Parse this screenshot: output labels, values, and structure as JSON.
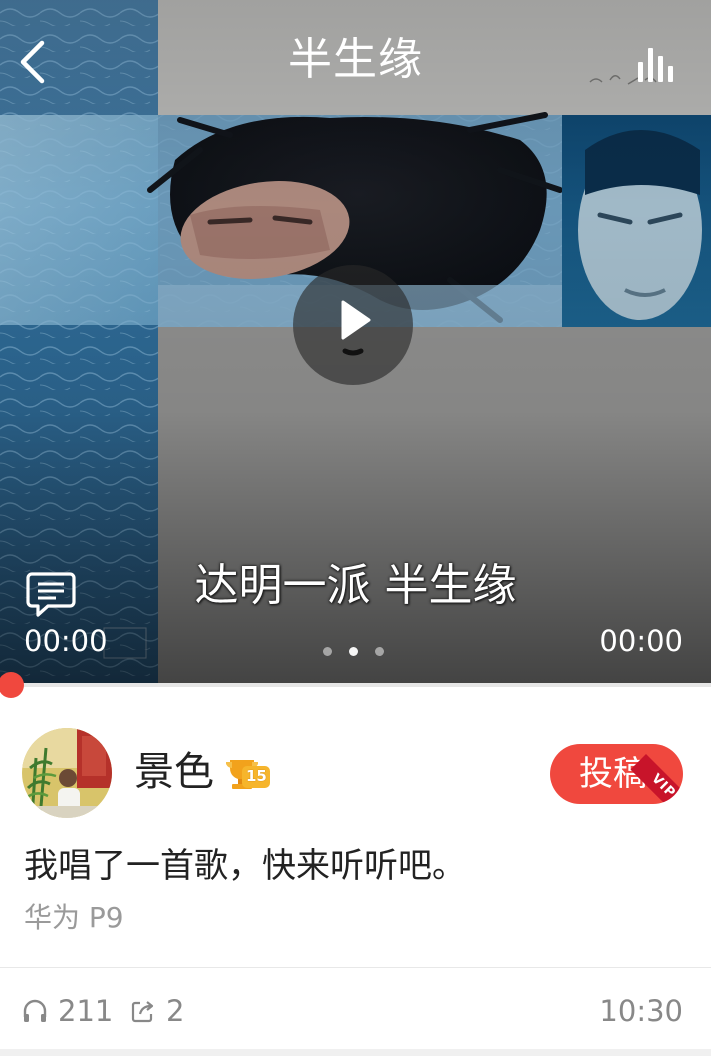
{
  "header": {
    "title": "半生缘",
    "back_icon": "chevron-left-icon",
    "equalizer_icon": "equalizer-icon"
  },
  "player": {
    "lyric": "达明一派 半生缘",
    "current_time": "00:00",
    "total_time": "00:00",
    "play_icon": "play-icon",
    "comment_icon": "comment-icon",
    "page_dots": {
      "count": 3,
      "active_index": 1
    },
    "progress_fraction": 0.0
  },
  "post": {
    "username": "景色",
    "level": "15",
    "submit_label": "投稿",
    "vip_label": "VIP",
    "text": "我唱了一首歌，快来听听吧。",
    "device": "华为 P9"
  },
  "stats": {
    "listens": "211",
    "shares": "2",
    "time": "10:30",
    "listen_icon": "headphones-icon",
    "share_icon": "share-icon"
  },
  "colors": {
    "accent": "#f0483e",
    "vip_ribbon": "#c8142a",
    "text_primary": "#222222",
    "text_secondary": "#9a9a9a"
  }
}
